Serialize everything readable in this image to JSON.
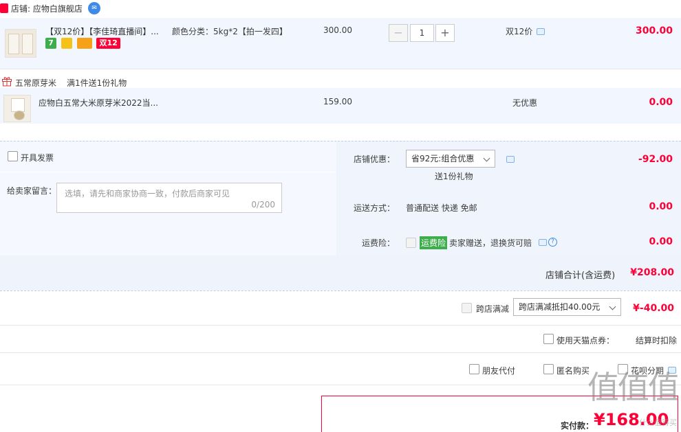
{
  "shop": {
    "label": "店铺: 应物白旗舰店",
    "badge": "tm",
    "ww_icon": "chat-icon"
  },
  "item1": {
    "title": "【双12价】【李佳琦直播间】...",
    "sku": "颜色分类：5kg*2【拍一发四】",
    "unit_price": "300.00",
    "quantity": "1",
    "minus": "−",
    "plus": "+",
    "promo": "双12价",
    "subtotal": "300.00",
    "tag_d12": "双12",
    "tag_7": "7"
  },
  "gift": {
    "category": "五常原芽米",
    "rule": "满1件送1份礼物"
  },
  "item2": {
    "title": "应物白五常大米原芽米2022当...",
    "unit_price": "159.00",
    "promo": "无优惠",
    "subtotal": "0.00"
  },
  "invoice": {
    "label": "开具发票"
  },
  "message": {
    "label": "给卖家留言：",
    "placeholder": "选填，请先和商家协商一致，付款后商家可见",
    "counter": "0/200"
  },
  "discount": {
    "label": "店铺优惠：",
    "selected": "省92元:组合优惠",
    "gift_note": "送1份礼物",
    "amount": "-92.00"
  },
  "shipping": {
    "label": "运送方式：",
    "value": "普通配送 快递 免邮",
    "amount": "0.00"
  },
  "insurance": {
    "label": "运费险：",
    "tag": "运费险",
    "value": "卖家赠送，退换货可赔",
    "amount": "0.00",
    "help": "?"
  },
  "shop_total": {
    "label": "店铺合计(含运费)",
    "amount": "¥208.00"
  },
  "cross_shop": {
    "label": "跨店满减",
    "selected": "跨店满减抵扣40.00元",
    "amount": "¥-40.00"
  },
  "points": {
    "label": "使用天猫点券：",
    "note": "结算时扣除"
  },
  "options": {
    "friend_pay": "朋友代付",
    "anonymous": "匿名购买",
    "huabei": "花呗分期"
  },
  "payment": {
    "label": "实付款：",
    "amount": "¥168.00"
  },
  "watermark": {
    "text": "值值值",
    "sub": "什么值得买"
  },
  "colors": {
    "price_red": "#ff0036",
    "link_blue": "#3d8ae7",
    "row_blue": "#f2f7ff",
    "insurance_green": "#3eae4d"
  }
}
